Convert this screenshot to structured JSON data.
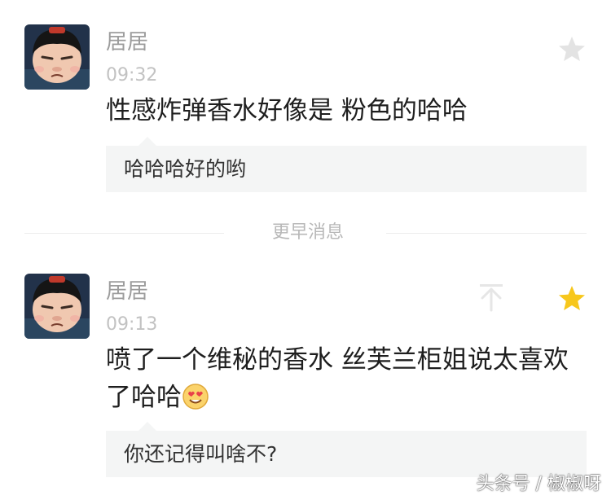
{
  "messages": [
    {
      "user": "居居",
      "time": "09:32",
      "text": "性感炸弹香水好像是 粉色的哈哈",
      "reply": "哈哈哈好的哟",
      "starred": false
    },
    {
      "user": "居居",
      "time": "09:13",
      "text_line1": "喷了一个维秘的香水 丝芙兰柜姐说太喜欢",
      "text_line2": "了哈哈",
      "reply": "你还记得叫啥不?",
      "starred": true
    }
  ],
  "divider": {
    "label": "更早消息"
  },
  "icons": {
    "star_inactive": "star-icon",
    "star_active": "star-filled-icon",
    "pin_top": "pin-to-top-icon",
    "emoji": "heart-eyes-emoji"
  },
  "colors": {
    "star_inactive": "#e3e3e3",
    "star_active": "#f7c71c",
    "reply_bg": "#f4f5f5",
    "username": "#9c9c9c"
  },
  "watermark": "头条号 / 椒椒呀"
}
